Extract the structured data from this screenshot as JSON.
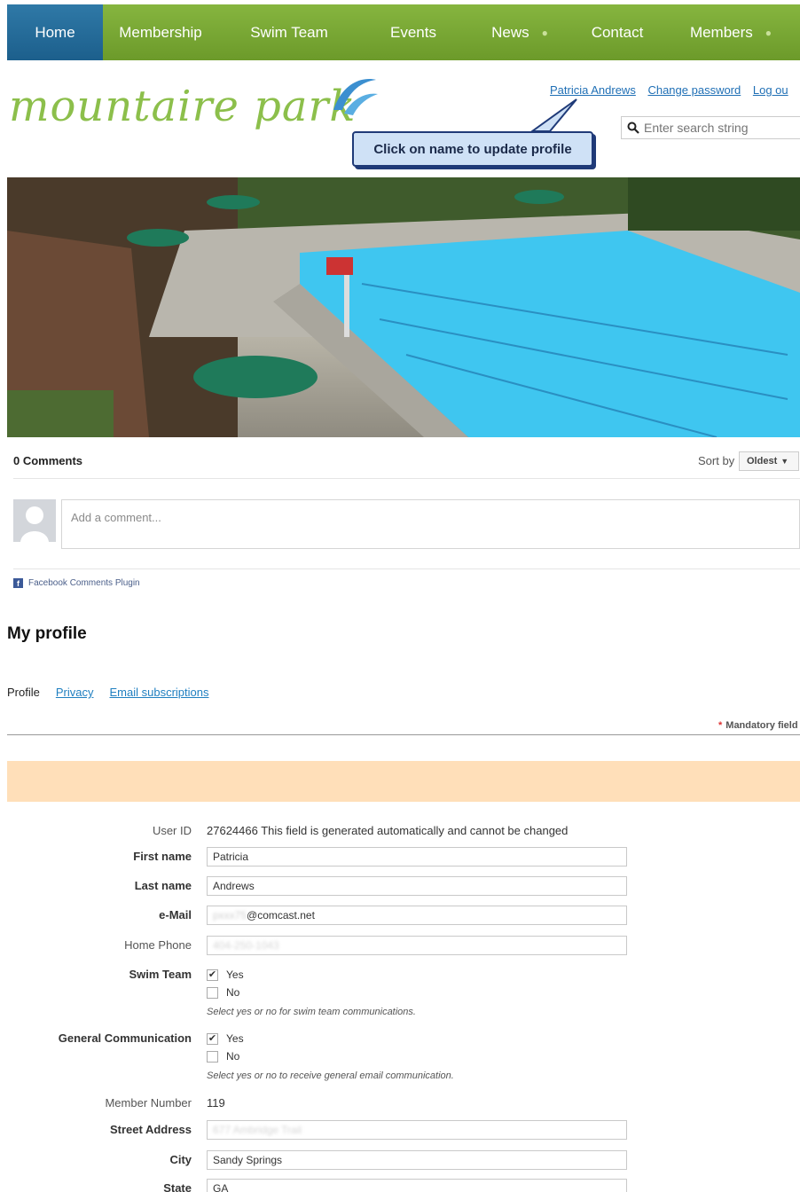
{
  "nav": {
    "items": [
      {
        "label": "Home",
        "active": true
      },
      {
        "label": "Membership"
      },
      {
        "label": "Swim Team"
      },
      {
        "label": "Events"
      },
      {
        "label": "News"
      },
      {
        "label": "Contact"
      },
      {
        "label": "Members"
      }
    ],
    "active_color": "#1c5f8c",
    "bar_color": "#7aa833"
  },
  "header": {
    "logo_text": "mountaire park",
    "user_name": "Patricia Andrews",
    "change_password": "Change password",
    "logout": "Log ou",
    "callout": "Click on name to update profile",
    "search_placeholder": "Enter search string"
  },
  "comments": {
    "count_label": "0 Comments",
    "sort_by_label": "Sort by",
    "sort_value": "Oldest",
    "add_placeholder": "Add a comment...",
    "plugin_label": "Facebook Comments Plugin"
  },
  "profile": {
    "title": "My profile",
    "tabs": {
      "profile": "Profile",
      "privacy": "Privacy",
      "email_subscriptions": "Email subscriptions"
    },
    "mandatory_label": "Mandatory field",
    "user_id_label": "User ID",
    "user_id_value": "27624466 This field is generated automatically and cannot be changed",
    "first_name_label": "First name",
    "first_name_value": "Patricia",
    "last_name_label": "Last name",
    "last_name_value": "Andrews",
    "email_label": "e-Mail",
    "email_value": "@comcast.net",
    "home_phone_label": "Home Phone",
    "swim_team_label": "Swim Team",
    "swim_team_yes": "Yes",
    "swim_team_no": "No",
    "swim_team_hint": "Select yes or no for swim team communications.",
    "general_comm_label": "General Communication",
    "general_comm_yes": "Yes",
    "general_comm_no": "No",
    "general_comm_hint": "Select yes or no to receive general email communication.",
    "member_number_label": "Member Number",
    "member_number_value": "119",
    "street_label": "Street Address",
    "city_label": "City",
    "city_value": "Sandy Springs",
    "state_label": "State",
    "state_value": "GA"
  },
  "colors": {
    "link": "#1f6fb5",
    "peach": "#ffdfb9",
    "logo": "#8cbf4b"
  }
}
